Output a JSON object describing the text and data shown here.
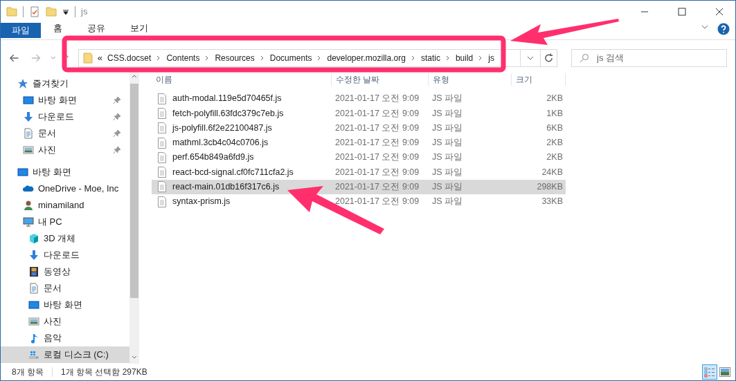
{
  "window": {
    "title": "js"
  },
  "ribbon": {
    "tabs": [
      {
        "label": "파일",
        "kind": "file"
      },
      {
        "label": "홈",
        "kind": "tab"
      },
      {
        "label": "공유",
        "kind": "tab"
      },
      {
        "label": "보기",
        "kind": "tab"
      }
    ]
  },
  "address_bar": {
    "overflow": "«",
    "path": [
      "CSS.docset",
      "Contents",
      "Resources",
      "Documents",
      "developer.mozilla.org",
      "static",
      "build",
      "js"
    ]
  },
  "search": {
    "placeholder": "js 검색"
  },
  "sidebar": {
    "items": [
      {
        "label": "즐겨찾기",
        "kind": "star",
        "children": [
          {
            "label": "바탕 화면",
            "kind": "desktop",
            "pinned": true,
            "selected": false
          },
          {
            "label": "다운로드",
            "kind": "download",
            "pinned": true,
            "selected": false
          },
          {
            "label": "문서",
            "kind": "document",
            "pinned": true,
            "selected": false
          },
          {
            "label": "사진",
            "kind": "photo",
            "pinned": true,
            "selected": false
          }
        ]
      },
      {
        "label": "바탕 화면",
        "kind": "desktop",
        "children": [
          {
            "label": "OneDrive - Moe, Inc",
            "kind": "cloud",
            "selected": false
          },
          {
            "label": "minamiland",
            "kind": "user",
            "selected": false
          },
          {
            "label": "내 PC",
            "kind": "pc",
            "selected": false,
            "children": [
              {
                "label": "3D 개체",
                "kind": "cube",
                "selected": false
              },
              {
                "label": "다운로드",
                "kind": "download",
                "selected": false
              },
              {
                "label": "동영상",
                "kind": "film",
                "selected": false
              },
              {
                "label": "문서",
                "kind": "document",
                "selected": false
              },
              {
                "label": "바탕 화면",
                "kind": "desktop",
                "selected": false
              },
              {
                "label": "사진",
                "kind": "photo",
                "selected": false
              },
              {
                "label": "음악",
                "kind": "music",
                "selected": false
              },
              {
                "label": "로컬 디스크 (C:)",
                "kind": "drive",
                "selected": true
              }
            ]
          }
        ]
      }
    ]
  },
  "table": {
    "columns": [
      "이름",
      "수정한 날짜",
      "유형",
      "크기"
    ],
    "rows": [
      {
        "name": "auth-modal.119e5d70465f.js",
        "date": "2021-01-17 오전 9:09",
        "type": "JS 파일",
        "size": "2KB",
        "selected": false
      },
      {
        "name": "fetch-polyfill.63fdc379c7eb.js",
        "date": "2021-01-17 오전 9:09",
        "type": "JS 파일",
        "size": "1KB",
        "selected": false
      },
      {
        "name": "js-polyfill.6f2e22100487.js",
        "date": "2021-01-17 오전 9:09",
        "type": "JS 파일",
        "size": "6KB",
        "selected": false
      },
      {
        "name": "mathml.3cb4c04c0706.js",
        "date": "2021-01-17 오전 9:09",
        "type": "JS 파일",
        "size": "2KB",
        "selected": false
      },
      {
        "name": "perf.654b849a6fd9.js",
        "date": "2021-01-17 오전 9:09",
        "type": "JS 파일",
        "size": "2KB",
        "selected": false
      },
      {
        "name": "react-bcd-signal.cf0fc711cfa2.js",
        "date": "2021-01-17 오전 9:09",
        "type": "JS 파일",
        "size": "24KB",
        "selected": false
      },
      {
        "name": "react-main.01db16f317c6.js",
        "date": "2021-01-17 오전 9:09",
        "type": "JS 파일",
        "size": "298KB",
        "selected": true
      },
      {
        "name": "syntax-prism.js",
        "date": "2021-01-17 오전 9:09",
        "type": "JS 파일",
        "size": "33KB",
        "selected": false
      }
    ]
  },
  "status_bar": {
    "items": [
      "8개 항목",
      "1개 항목 선택함 297KB"
    ]
  },
  "view_buttons": [
    {
      "kind": "details",
      "selected": true
    },
    {
      "kind": "large_icons",
      "selected": false
    }
  ]
}
